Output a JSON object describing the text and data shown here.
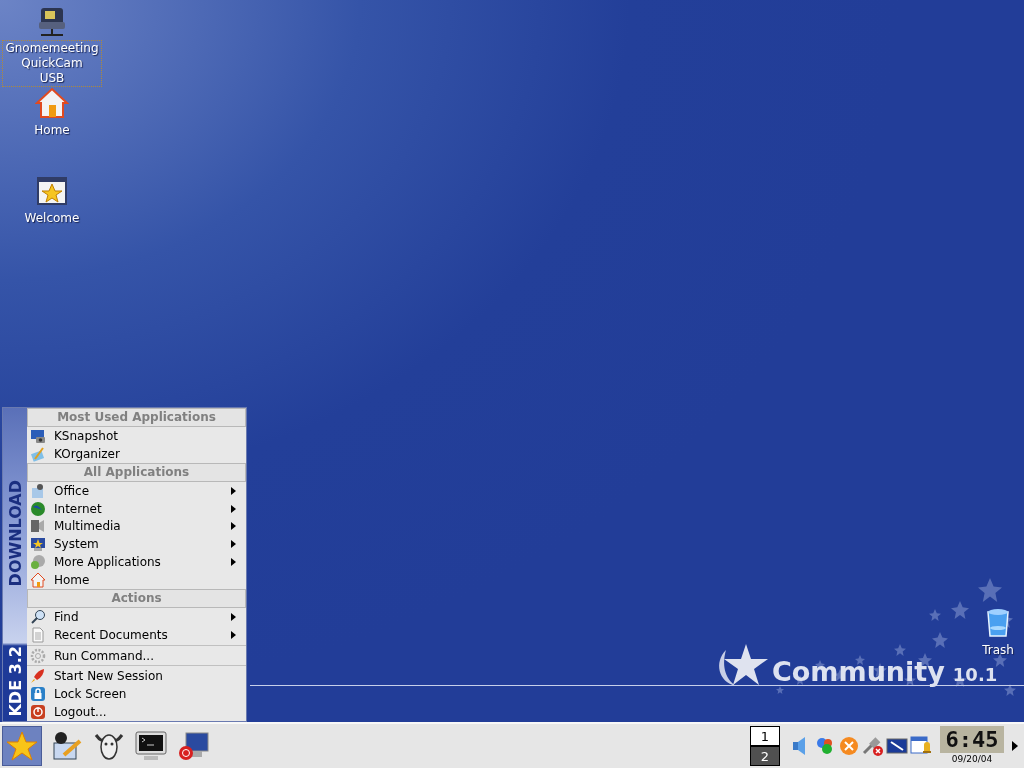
{
  "desktop_icons": [
    {
      "label": "Gnomemeeting\nQuickCam\nUSB",
      "selected": true
    },
    {
      "label": "Home",
      "selected": false
    },
    {
      "label": "Welcome",
      "selected": false
    },
    {
      "label": "Trash",
      "selected": false
    }
  ],
  "wallpaper_logo": {
    "name": "Community",
    "version": "10.1"
  },
  "start_menu": {
    "banner_top": "DOWNLOAD",
    "banner_bottom": "KDE 3.2",
    "entries": [
      {
        "kind": "header",
        "label": "Most Used Applications"
      },
      {
        "kind": "item",
        "label": "KSnapshot",
        "submenu": false
      },
      {
        "kind": "item",
        "label": "KOrganizer",
        "submenu": false
      },
      {
        "kind": "header",
        "label": "All Applications"
      },
      {
        "kind": "item",
        "label": "Office",
        "submenu": true
      },
      {
        "kind": "item",
        "label": "Internet",
        "submenu": true
      },
      {
        "kind": "item",
        "label": "Multimedia",
        "submenu": true
      },
      {
        "kind": "item",
        "label": "System",
        "submenu": true
      },
      {
        "kind": "item",
        "label": "More Applications",
        "submenu": true
      },
      {
        "kind": "item",
        "label": "Home",
        "submenu": false
      },
      {
        "kind": "header",
        "label": "Actions"
      },
      {
        "kind": "item",
        "label": "Find",
        "submenu": true
      },
      {
        "kind": "item",
        "label": "Recent Documents",
        "submenu": true
      },
      {
        "kind": "separator"
      },
      {
        "kind": "item",
        "label": "Run Command...",
        "submenu": false
      },
      {
        "kind": "separator"
      },
      {
        "kind": "item",
        "label": "Start New Session",
        "submenu": false
      },
      {
        "kind": "item",
        "label": "Lock Screen",
        "submenu": false
      },
      {
        "kind": "item",
        "label": "Logout...",
        "submenu": false
      }
    ]
  },
  "taskbar": {
    "start_pressed": true,
    "pager": [
      {
        "label": "1",
        "selected": false
      },
      {
        "label": "2",
        "selected": true
      }
    ],
    "clock": {
      "time": "6:45",
      "date": "09/20/04"
    }
  }
}
